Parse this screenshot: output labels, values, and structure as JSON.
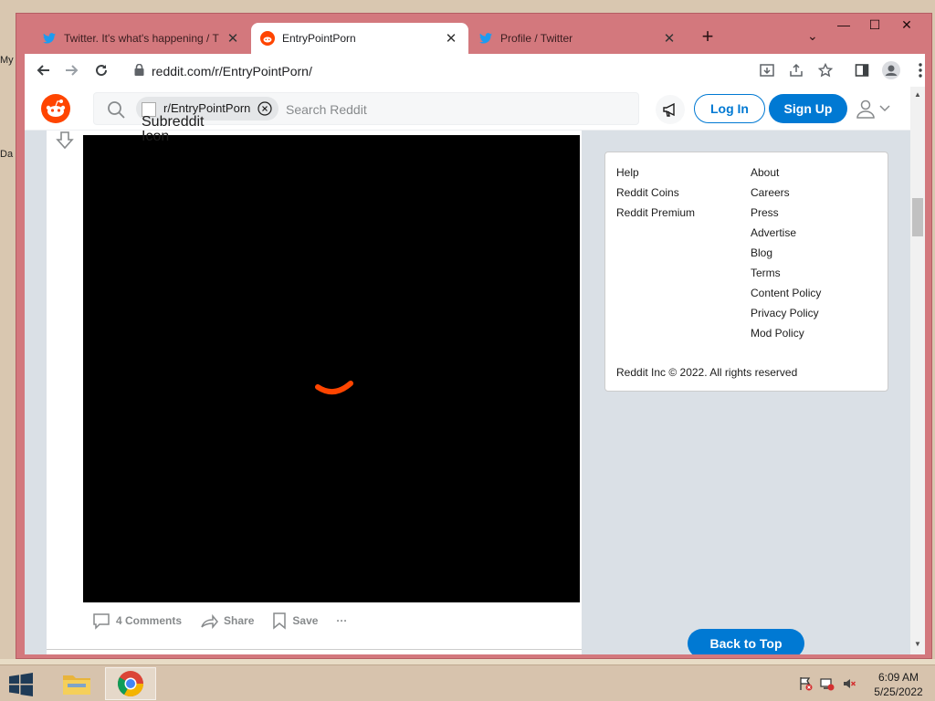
{
  "desktop": {
    "label_top": "My",
    "label_mid": "Da"
  },
  "browser": {
    "tabs": [
      {
        "title": "Twitter. It's what's happening / T",
        "icon": "twitter-bird-icon",
        "active": false
      },
      {
        "title": "EntryPointPorn",
        "icon": "reddit-icon",
        "active": true
      },
      {
        "title": "Profile / Twitter",
        "icon": "twitter-bird-icon",
        "active": false
      }
    ],
    "new_tab_label": "+",
    "address": "reddit.com/r/EntryPointPorn/"
  },
  "reddit": {
    "search": {
      "chip_label": "r/EntryPointPorn",
      "chip_alt_text": "Subreddit Icon",
      "placeholder": "Search Reddit"
    },
    "login_label": "Log In",
    "signup_label": "Sign Up",
    "post": {
      "comments_label": "4 Comments",
      "share_label": "Share",
      "save_label": "Save",
      "more_label": "···"
    },
    "footer": {
      "col1": [
        "Help",
        "Reddit Coins",
        "Reddit Premium"
      ],
      "col2": [
        "About",
        "Careers",
        "Press",
        "Advertise",
        "Blog",
        "Terms",
        "Content Policy",
        "Privacy Policy",
        "Mod Policy"
      ],
      "copyright": "Reddit Inc © 2022. All rights reserved"
    },
    "back_to_top_label": "Back to Top",
    "colors": {
      "brand_orange": "#ff4500",
      "accent_blue": "#0079d3"
    }
  },
  "taskbar": {
    "time": "6:09 AM",
    "date": "5/25/2022"
  }
}
